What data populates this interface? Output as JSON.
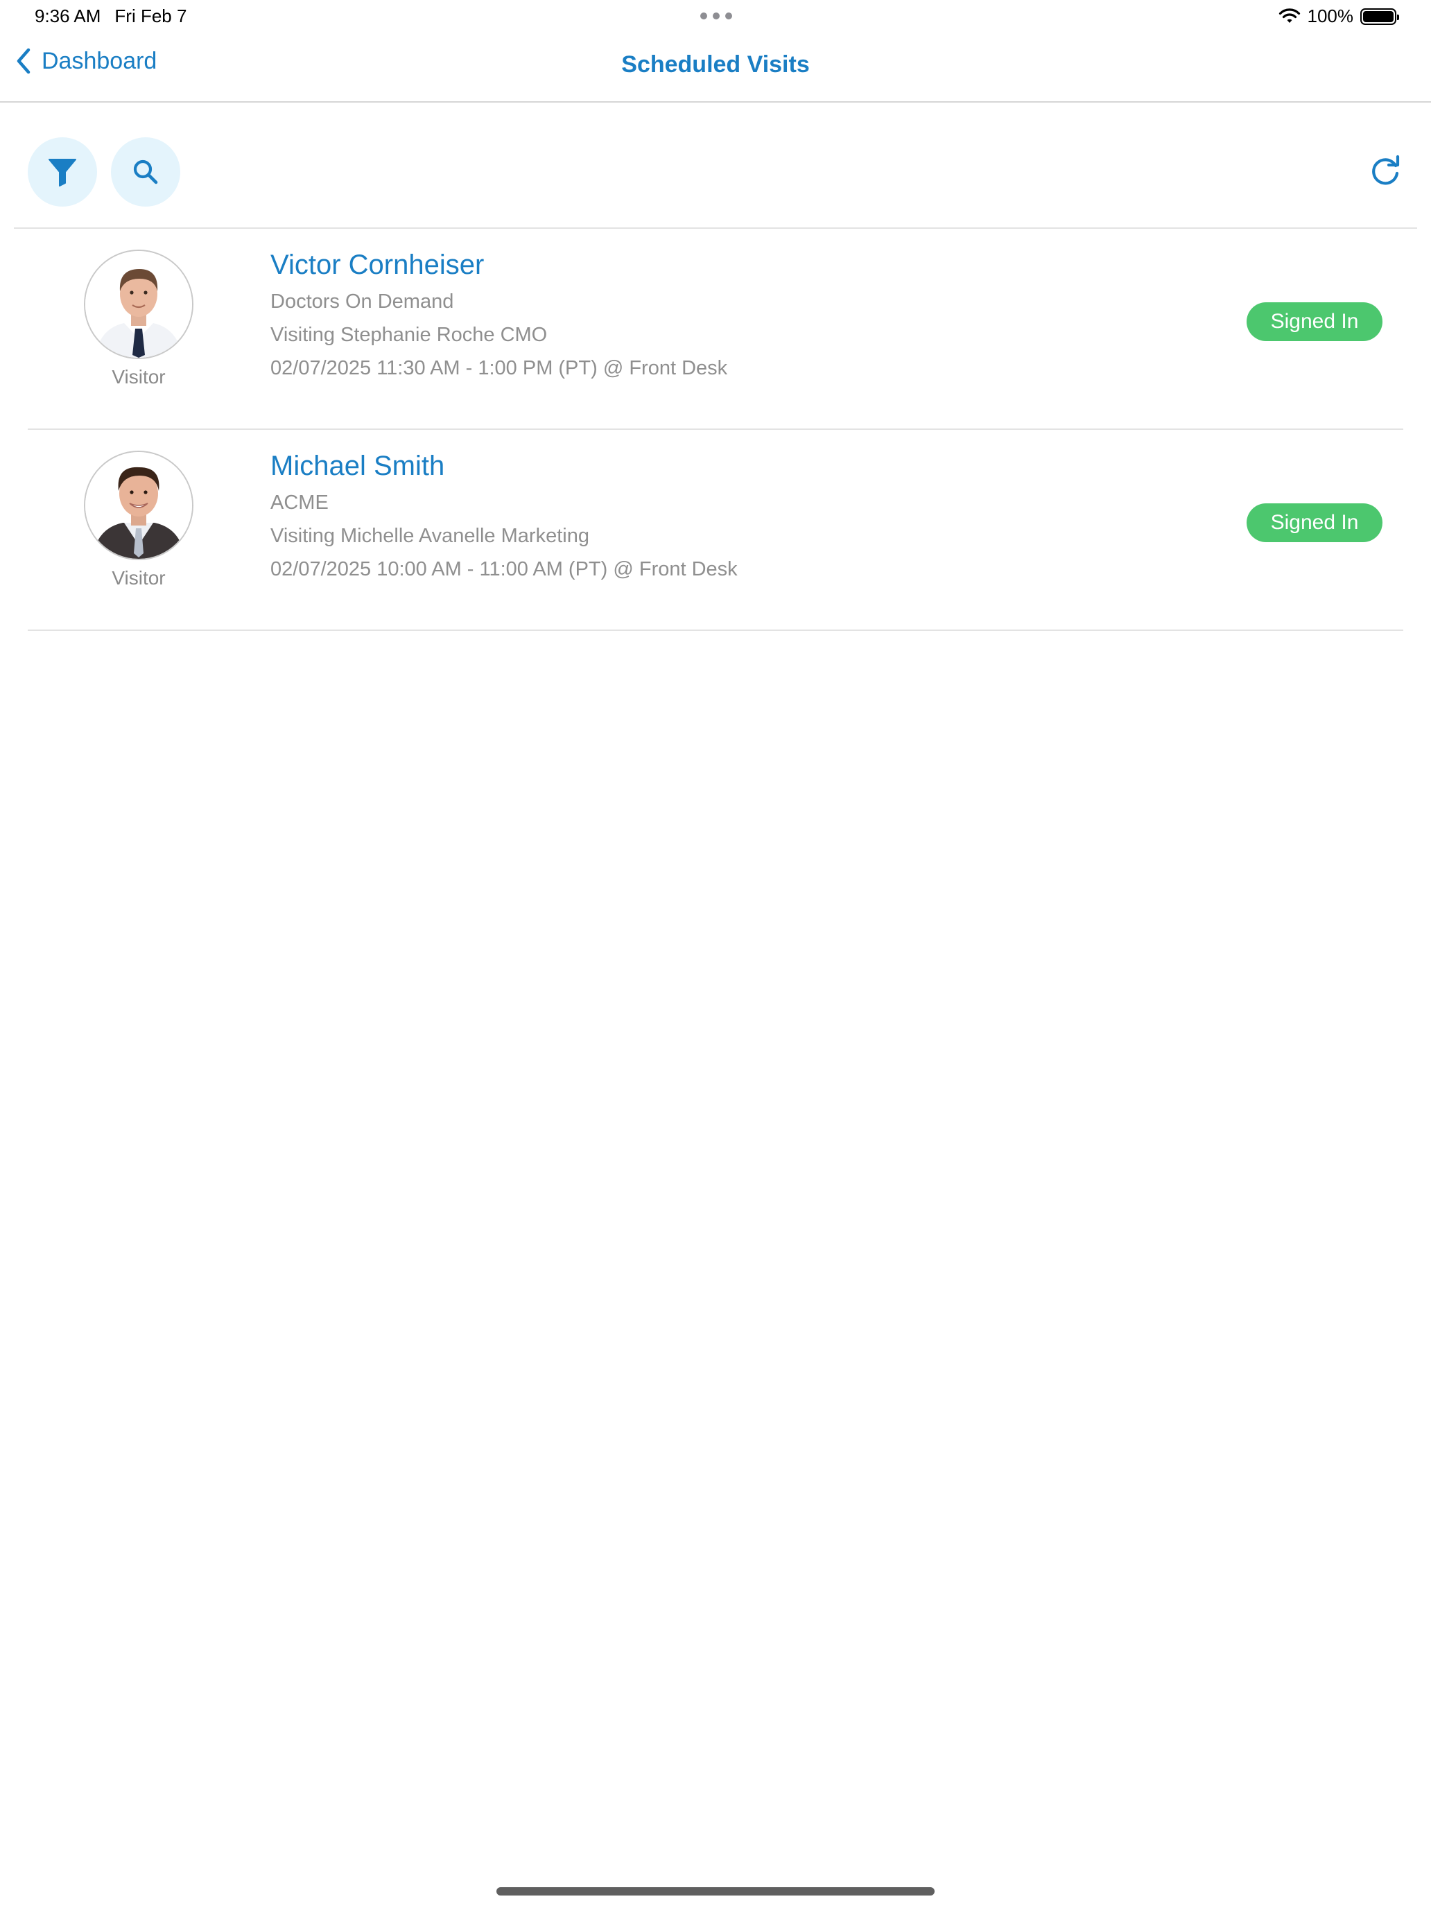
{
  "status_bar": {
    "time": "9:36 AM",
    "date": "Fri Feb 7",
    "battery_percent": "100%",
    "battery_level": 1.0
  },
  "nav": {
    "back_label": "Dashboard",
    "title": "Scheduled Visits"
  },
  "toolbar": {
    "filter_icon": "filter-icon",
    "search_icon": "search-icon",
    "refresh_icon": "refresh-icon"
  },
  "colors": {
    "accent": "#1a7ec4",
    "button_bg": "#e4f4fc",
    "signed_in": "#4cc76e",
    "secondary_text": "#8f8f8f"
  },
  "visits": [
    {
      "name": "Victor Cornheiser",
      "company": "Doctors On Demand",
      "host": "Visiting Stephanie Roche CMO",
      "schedule": "02/07/2025 11:30 AM - 1:00 PM (PT) @ Front Desk",
      "role": "Visitor",
      "status": "Signed In"
    },
    {
      "name": "Michael Smith",
      "company": "ACME",
      "host": "Visiting Michelle Avanelle Marketing",
      "schedule": "02/07/2025 10:00 AM - 11:00 AM (PT) @ Front Desk",
      "role": "Visitor",
      "status": "Signed In"
    }
  ]
}
